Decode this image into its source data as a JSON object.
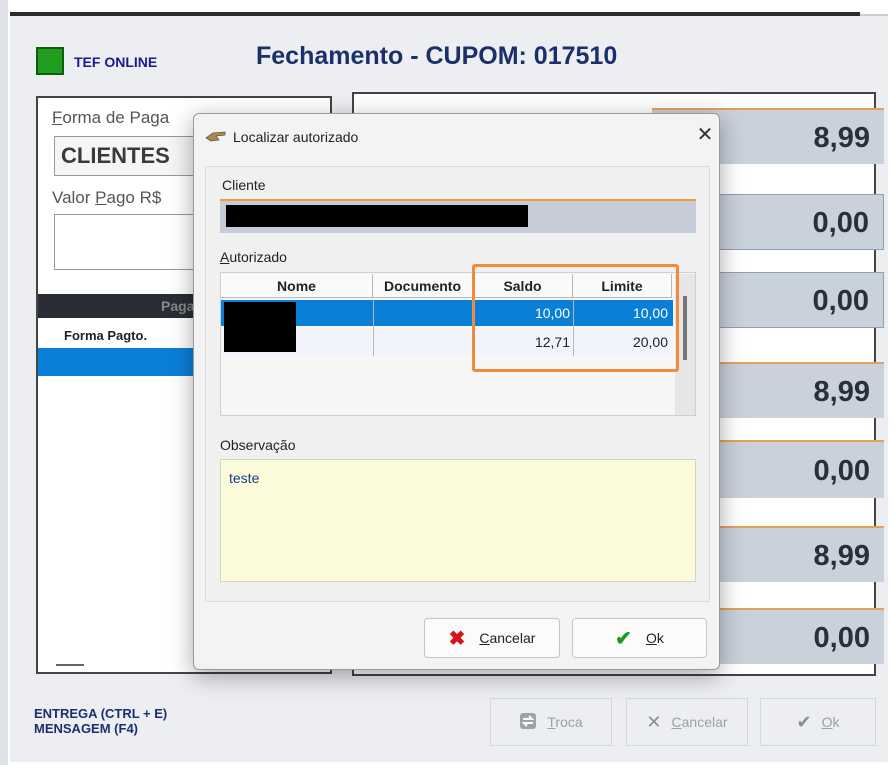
{
  "background": {
    "tef_status": "TEF ONLINE",
    "title": "Fechamento - CUPOM: 017510",
    "forma_label_prefix": "F",
    "forma_label_rest": "orma de Paga",
    "forma_value": "CLIENTES",
    "valor_label": "Valor ",
    "valor_label_u": "P",
    "valor_label_rest": "ago R$",
    "grid_header": "Pagam",
    "grid_col": "Forma Pagto.",
    "values": [
      "8,99",
      "0,00",
      "0,00",
      "8,99",
      "0,00",
      "8,99",
      "0,00"
    ],
    "entrega": "ENTREGA (CTRL + E)",
    "mensagem": "MENSAGEM (F4)",
    "btn_troca_u": "T",
    "btn_troca_rest": "roca",
    "btn_cancelar_u": "C",
    "btn_cancelar_rest": "ancelar",
    "btn_ok_u": "O",
    "btn_ok_rest": "k"
  },
  "dialog": {
    "title": "Localizar autorizado",
    "cliente_label": "Cliente",
    "autorizado_label_u": "A",
    "autorizado_label_rest": "utorizado",
    "columns": [
      "Nome",
      "Documento",
      "Saldo",
      "Limite"
    ],
    "rows": [
      {
        "saldo": "10,00",
        "limite": "10,00"
      },
      {
        "saldo": "12,71",
        "limite": "20,00"
      }
    ],
    "obs_label": "Observação",
    "obs_text": "teste",
    "btn_cancelar_u": "C",
    "btn_cancelar_rest": "ancelar",
    "btn_ok_u": "O",
    "btn_ok_rest": "k"
  },
  "colors": {
    "accent_orange": "#f08a3c",
    "selection_blue": "#0a7fd8",
    "title_blue": "#1b2f6b"
  },
  "icons": {
    "close": "close-icon",
    "dialog": "hand-pointer-icon",
    "cancel": "x-icon",
    "ok": "checkmark-icon",
    "troca": "swap-icon"
  }
}
